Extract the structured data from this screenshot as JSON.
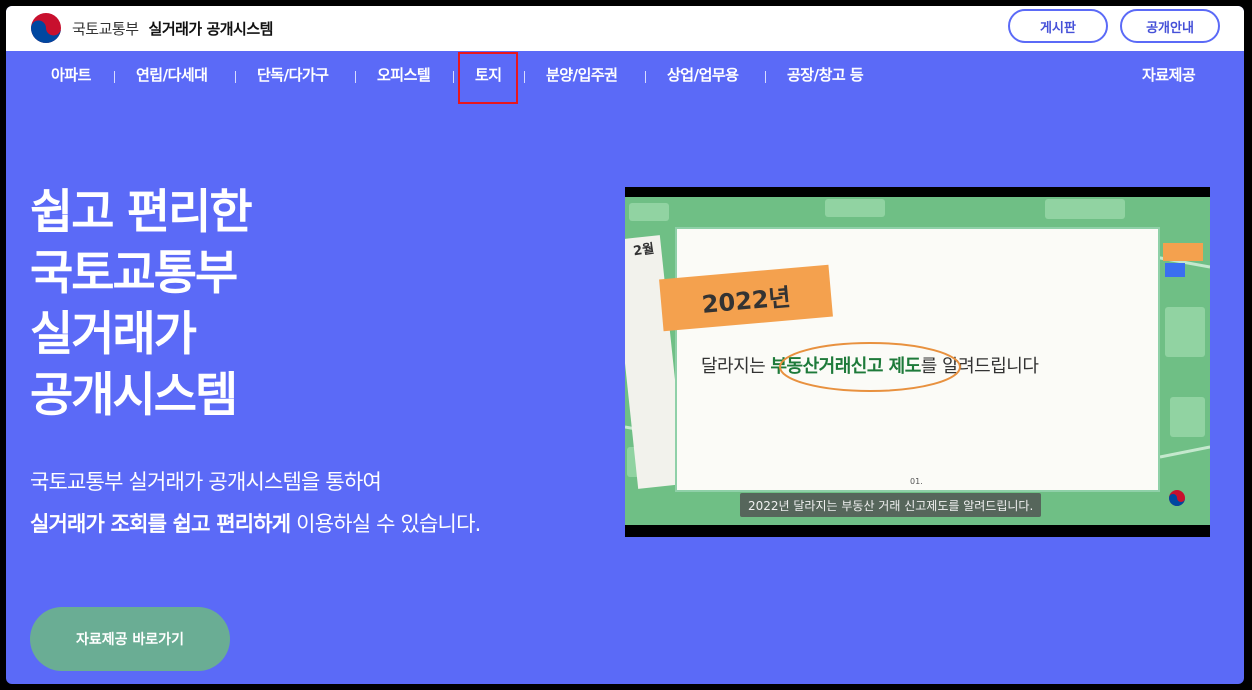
{
  "header": {
    "ministry": "국토교통부",
    "system_name": "실거래가 공개시스템",
    "buttons": {
      "board": "게시판",
      "notice": "공개안내"
    }
  },
  "nav": {
    "items": [
      "아파트",
      "연립/다세대",
      "단독/다가구",
      "오피스텔",
      "토지",
      "분양/입주권",
      "상업/업무용",
      "공장/창고 등"
    ],
    "right": "자료제공",
    "highlighted": "토지"
  },
  "hero": {
    "title_lines": [
      "쉽고 편리한",
      "국토교통부",
      "실거래가",
      "공개시스템"
    ],
    "desc_line1": "국토교통부 실거래가 공개시스템을 통하여",
    "desc_line2_bold": "실거래가 조회를 쉽고 편리하게",
    "desc_line2_rest": " 이용하실 수 있습니다.",
    "cta": "자료제공 바로가기"
  },
  "video": {
    "month": "2월",
    "year_tag": "2022년",
    "headline_pre": "달라지는 ",
    "headline_bold": "부동산거래신고 제도",
    "headline_post": "를 알려드립니다",
    "slide_number": "01.",
    "caption": "2022년 달라지는 부동산 거래 신고제도를 알려드립니다."
  },
  "colors": {
    "background": "#5b6af7",
    "cta": "#6aad94",
    "highlight": "#e8161c"
  }
}
